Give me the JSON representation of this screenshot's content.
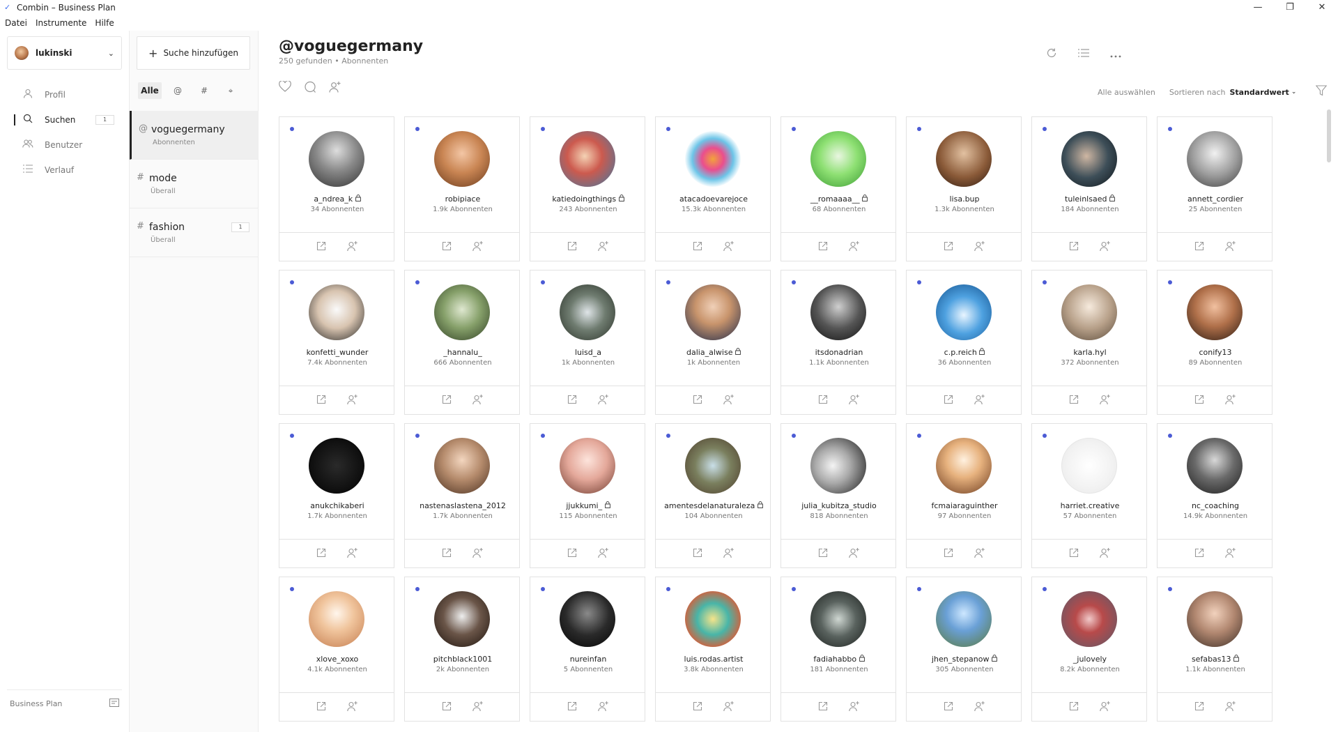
{
  "window": {
    "title": "Combin – Business Plan",
    "controls": [
      "—",
      "❐",
      "✕"
    ]
  },
  "menu": [
    "Datei",
    "Instrumente",
    "Hilfe"
  ],
  "sidebar": {
    "user": "lukinski",
    "items": [
      {
        "label": "Profil",
        "icon": "person-icon",
        "active": false
      },
      {
        "label": "Suchen",
        "icon": "search-icon",
        "active": true,
        "count": "1"
      },
      {
        "label": "Benutzer",
        "icon": "users-icon",
        "active": false
      },
      {
        "label": "Verlauf",
        "icon": "list-icon",
        "active": false
      }
    ],
    "footer": "Business Plan"
  },
  "searchpanel": {
    "add_label": "Suche hinzufügen",
    "filters": [
      "Alle",
      "@",
      "#",
      "⌖"
    ],
    "searches": [
      {
        "prefix": "@",
        "name": "voguegermany",
        "sub": "Abonnenten",
        "active": true
      },
      {
        "prefix": "#",
        "name": "mode",
        "sub": "Überall",
        "active": false
      },
      {
        "prefix": "#",
        "name": "fashion",
        "sub": "Überall",
        "active": false,
        "count": "1"
      }
    ]
  },
  "main": {
    "title": "@voguegermany",
    "found": "250 gefunden",
    "separator": "•",
    "sub_type": "Abonnenten",
    "select_all": "Alle auswählen",
    "sort_label": "Sortieren nach",
    "sort_value": "Standardwert",
    "accent": "#4b5bd5"
  },
  "cards": [
    {
      "name": "a_ndrea_k",
      "followers": "34 Abonnenten",
      "locked": true
    },
    {
      "name": "robipiace",
      "followers": "1.9k Abonnenten",
      "locked": false
    },
    {
      "name": "katiedoingthings",
      "followers": "243 Abonnenten",
      "locked": true
    },
    {
      "name": "atacadoevarejoce",
      "followers": "15.3k Abonnenten",
      "locked": false
    },
    {
      "name": "__romaaaa__",
      "followers": "68 Abonnenten",
      "locked": true
    },
    {
      "name": "lisa.bup",
      "followers": "1.3k Abonnenten",
      "locked": false
    },
    {
      "name": "tuleinlsaed",
      "followers": "184 Abonnenten",
      "locked": true
    },
    {
      "name": "annett_cordier",
      "followers": "25 Abonnenten",
      "locked": false
    },
    {
      "name": "konfetti_wunder",
      "followers": "7.4k Abonnenten",
      "locked": false
    },
    {
      "name": "_hannalu_",
      "followers": "666 Abonnenten",
      "locked": false
    },
    {
      "name": "luisd_a",
      "followers": "1k Abonnenten",
      "locked": false
    },
    {
      "name": "dalia_alwise",
      "followers": "1k Abonnenten",
      "locked": true
    },
    {
      "name": "itsdonadrian",
      "followers": "1.1k Abonnenten",
      "locked": false
    },
    {
      "name": "c.p.reich",
      "followers": "36 Abonnenten",
      "locked": true
    },
    {
      "name": "karla.hyl",
      "followers": "372 Abonnenten",
      "locked": false
    },
    {
      "name": "conify13",
      "followers": "89 Abonnenten",
      "locked": false
    },
    {
      "name": "anukchikaberi",
      "followers": "1.7k Abonnenten",
      "locked": false
    },
    {
      "name": "nastenaslastena_2012",
      "followers": "1.7k Abonnenten",
      "locked": false
    },
    {
      "name": "jjukkumi_",
      "followers": "115 Abonnenten",
      "locked": true
    },
    {
      "name": "amentesdelanaturaleza",
      "followers": "104 Abonnenten",
      "locked": true
    },
    {
      "name": "julia_kubitza_studio",
      "followers": "818 Abonnenten",
      "locked": false
    },
    {
      "name": "fcmaiaraguinther",
      "followers": "97 Abonnenten",
      "locked": false
    },
    {
      "name": "harriet.creative",
      "followers": "57 Abonnenten",
      "locked": false
    },
    {
      "name": "nc_coaching",
      "followers": "14.9k Abonnenten",
      "locked": false
    },
    {
      "name": "xlove_xoxo",
      "followers": "4.1k Abonnenten",
      "locked": false
    },
    {
      "name": "pitchblack1001",
      "followers": "2k Abonnenten",
      "locked": false
    },
    {
      "name": "nureinfan",
      "followers": "5 Abonnenten",
      "locked": false
    },
    {
      "name": "luis.rodas.artist",
      "followers": "3.8k Abonnenten",
      "locked": false
    },
    {
      "name": "fadiahabbo",
      "followers": "181 Abonnenten",
      "locked": true
    },
    {
      "name": "jhen_stepanow",
      "followers": "305 Abonnenten",
      "locked": true
    },
    {
      "name": "_julovely",
      "followers": "8.2k Abonnenten",
      "locked": false
    },
    {
      "name": "sefabas13",
      "followers": "1.1k Abonnenten",
      "locked": true
    }
  ]
}
